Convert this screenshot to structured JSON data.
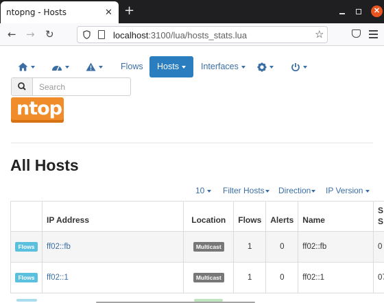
{
  "browser": {
    "tab_title": "ntopng - Hosts",
    "url_host": "localhost",
    "url_rest": ":3100/lua/hosts_stats.lua"
  },
  "nav": {
    "flows": "Flows",
    "hosts": "Hosts",
    "interfaces": "Interfaces"
  },
  "search": {
    "placeholder": "Search"
  },
  "logo_text": "ntop",
  "page_title": "All Hosts",
  "controls": {
    "page_size": "10",
    "filter_hosts": "Filter Hosts",
    "direction": "Direction",
    "ip_version": "IP Version"
  },
  "table": {
    "headers": {
      "ip_address": "IP Address",
      "location": "Location",
      "flows": "Flows",
      "alerts": "Alerts",
      "name": "Name",
      "seen_since": "S\nS"
    },
    "rows": [
      {
        "flows_badge": "Flows",
        "ip": "ff02::fb",
        "location": "Multicast",
        "flows": "1",
        "alerts": "0",
        "name": "ff02::fb",
        "seen_since": "0"
      },
      {
        "flows_badge": "Flows",
        "ip": "ff02::1",
        "location": "Multicast",
        "flows": "1",
        "alerts": "0",
        "name": "ff02::1",
        "seen_since": "07"
      }
    ]
  },
  "colors": {
    "accent": "#2a7ec0",
    "link": "#3a6ea5",
    "logo": "#f08c2a",
    "badge_flows": "#5bc0de",
    "badge_multicast": "#777777"
  }
}
